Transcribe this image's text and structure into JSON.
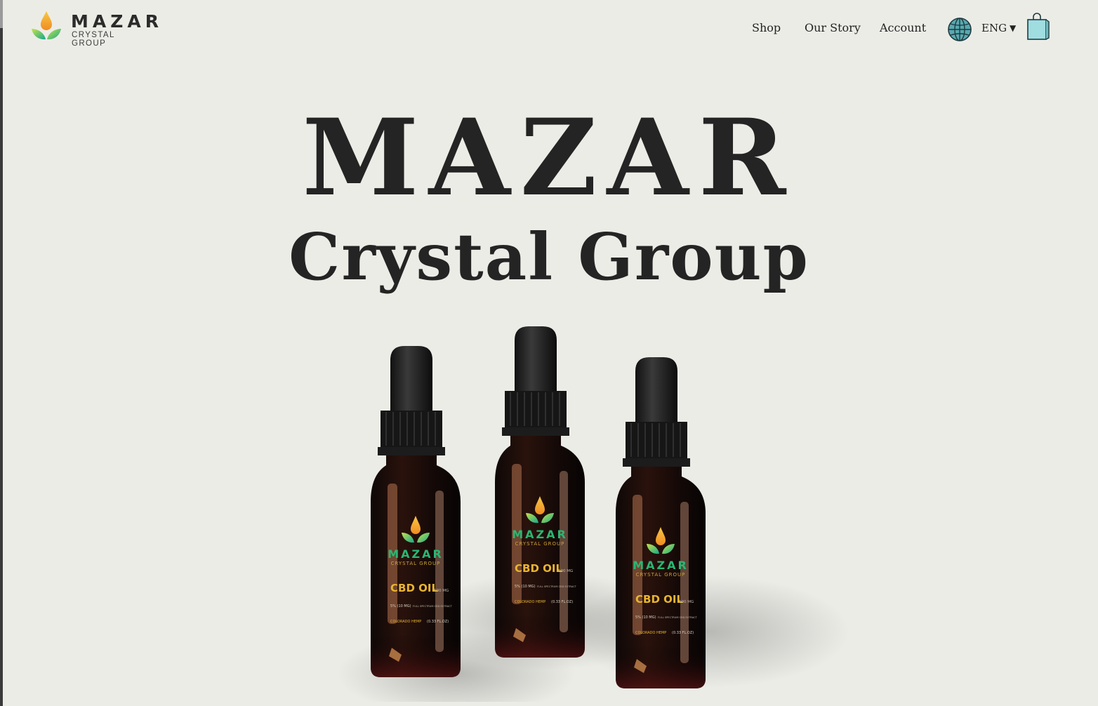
{
  "brand": {
    "name": "MAZAR",
    "tagline": "CRYSTAL GROUP"
  },
  "nav": {
    "shop": "Shop",
    "our_story": "Our Story",
    "account": "Account",
    "language": "ENG",
    "globe_icon": "globe-icon",
    "cart_icon": "shopping-bag-icon"
  },
  "hero": {
    "title": "MAZAR",
    "subtitle": "Crystal Group"
  },
  "product": {
    "brand": "MAZAR",
    "brand_sub": "CRYSTAL GROUP",
    "name": "CBD OIL",
    "strength": "500 MG",
    "concentration": "5% (10 MG)",
    "extract": "FULL SPECTRUM CBD EXTRACT",
    "origin": "COLORADO HEMP",
    "volume": "(0.33 FL.OZ)"
  },
  "colors": {
    "background": "#ecece7",
    "text": "#242424",
    "bottle": "#1a0f0d",
    "label_gold": "#e8b430",
    "leaf_green": "#2bb673",
    "cart": "#9fdde0"
  }
}
